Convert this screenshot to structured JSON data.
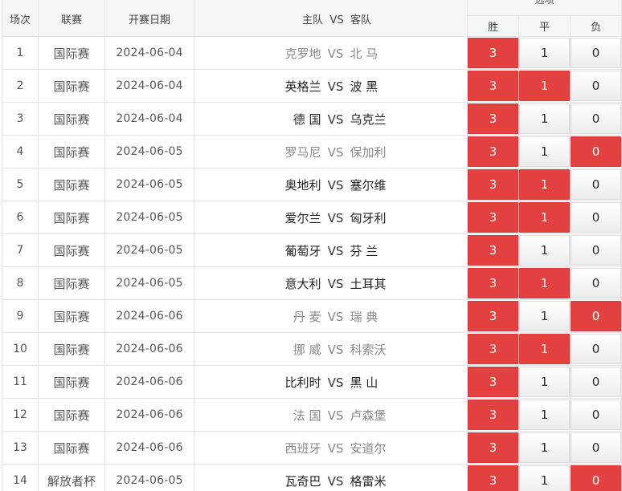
{
  "header": {
    "no": "场次",
    "league": "联赛",
    "date": "开赛日期",
    "home": "主队",
    "vs": "VS",
    "away": "客队",
    "group": "选项",
    "win": "胜",
    "draw": "平",
    "lose": "负"
  },
  "colors": {
    "selected": "#e34040",
    "unselected": "#f2f2f2"
  },
  "rows": [
    {
      "no": "1",
      "league": "国际赛",
      "date": "2024-06-04",
      "home": "克罗地",
      "vs": "VS",
      "away": "北 马",
      "win": "3",
      "draw": "1",
      "lose": "0",
      "win_on": true,
      "draw_on": false,
      "lose_on": false,
      "dim": true
    },
    {
      "no": "2",
      "league": "国际赛",
      "date": "2024-06-04",
      "home": "英格兰",
      "vs": "VS",
      "away": "波 黑",
      "win": "3",
      "draw": "1",
      "lose": "0",
      "win_on": true,
      "draw_on": true,
      "lose_on": false,
      "dim": false
    },
    {
      "no": "3",
      "league": "国际赛",
      "date": "2024-06-04",
      "home": "德 国",
      "vs": "VS",
      "away": "乌克兰",
      "win": "3",
      "draw": "1",
      "lose": "0",
      "win_on": true,
      "draw_on": false,
      "lose_on": false,
      "dim": false
    },
    {
      "no": "4",
      "league": "国际赛",
      "date": "2024-06-05",
      "home": "罗马尼",
      "vs": "VS",
      "away": "保加利",
      "win": "3",
      "draw": "1",
      "lose": "0",
      "win_on": true,
      "draw_on": false,
      "lose_on": true,
      "dim": true
    },
    {
      "no": "5",
      "league": "国际赛",
      "date": "2024-06-05",
      "home": "奥地利",
      "vs": "VS",
      "away": "塞尔维",
      "win": "3",
      "draw": "1",
      "lose": "0",
      "win_on": true,
      "draw_on": true,
      "lose_on": false,
      "dim": false
    },
    {
      "no": "6",
      "league": "国际赛",
      "date": "2024-06-05",
      "home": "爱尔兰",
      "vs": "VS",
      "away": "匈牙利",
      "win": "3",
      "draw": "1",
      "lose": "0",
      "win_on": true,
      "draw_on": true,
      "lose_on": false,
      "dim": false
    },
    {
      "no": "7",
      "league": "国际赛",
      "date": "2024-06-05",
      "home": "葡萄牙",
      "vs": "VS",
      "away": "芬 兰",
      "win": "3",
      "draw": "1",
      "lose": "0",
      "win_on": true,
      "draw_on": false,
      "lose_on": false,
      "dim": false
    },
    {
      "no": "8",
      "league": "国际赛",
      "date": "2024-06-05",
      "home": "意大利",
      "vs": "VS",
      "away": "土耳其",
      "win": "3",
      "draw": "1",
      "lose": "0",
      "win_on": true,
      "draw_on": true,
      "lose_on": false,
      "dim": false
    },
    {
      "no": "9",
      "league": "国际赛",
      "date": "2024-06-06",
      "home": "丹 麦",
      "vs": "VS",
      "away": "瑞 典",
      "win": "3",
      "draw": "1",
      "lose": "0",
      "win_on": true,
      "draw_on": false,
      "lose_on": true,
      "dim": true
    },
    {
      "no": "10",
      "league": "国际赛",
      "date": "2024-06-06",
      "home": "挪 威",
      "vs": "VS",
      "away": "科索沃",
      "win": "3",
      "draw": "1",
      "lose": "0",
      "win_on": true,
      "draw_on": true,
      "lose_on": false,
      "dim": true
    },
    {
      "no": "11",
      "league": "国际赛",
      "date": "2024-06-06",
      "home": "比利时",
      "vs": "VS",
      "away": "黑 山",
      "win": "3",
      "draw": "1",
      "lose": "0",
      "win_on": true,
      "draw_on": false,
      "lose_on": false,
      "dim": false
    },
    {
      "no": "12",
      "league": "国际赛",
      "date": "2024-06-06",
      "home": "法 国",
      "vs": "VS",
      "away": "卢森堡",
      "win": "3",
      "draw": "1",
      "lose": "0",
      "win_on": true,
      "draw_on": false,
      "lose_on": false,
      "dim": true
    },
    {
      "no": "13",
      "league": "国际赛",
      "date": "2024-06-06",
      "home": "西班牙",
      "vs": "VS",
      "away": "安道尔",
      "win": "3",
      "draw": "1",
      "lose": "0",
      "win_on": true,
      "draw_on": false,
      "lose_on": false,
      "dim": true
    },
    {
      "no": "14",
      "league": "解放者杯",
      "date": "2024-06-05",
      "home": "瓦奇巴",
      "vs": "VS",
      "away": "格雷米",
      "win": "3",
      "draw": "1",
      "lose": "0",
      "win_on": true,
      "draw_on": false,
      "lose_on": true,
      "dim": false
    }
  ]
}
